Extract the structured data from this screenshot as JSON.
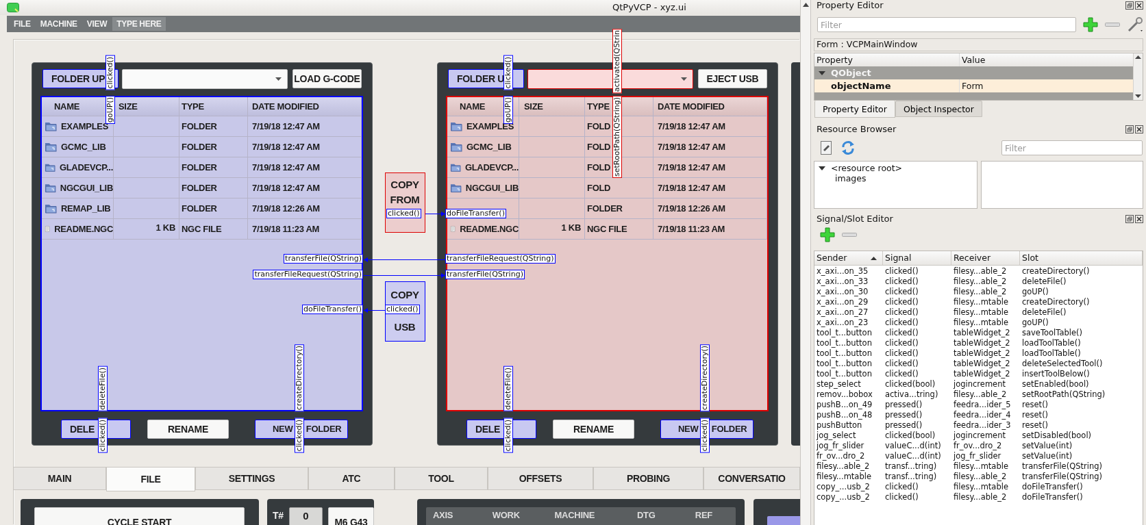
{
  "window": {
    "title": "QtPyVCP - xyz.ui"
  },
  "menu": [
    {
      "label": "FILE",
      "selected": false
    },
    {
      "label": "MACHINE",
      "selected": false
    },
    {
      "label": "VIEW",
      "selected": false
    },
    {
      "label": "TYPE HERE",
      "selected": true
    }
  ],
  "file_panels": [
    {
      "color": "#0000ff",
      "folder_up": {
        "label": "FOLDER UP",
        "highlighted": true
      },
      "combo": {
        "highlighted": false
      },
      "action": {
        "label": "LOAD G-CODE",
        "highlighted": false
      },
      "columns": [
        "NAME",
        "SIZE",
        "TYPE",
        "DATE MODIFIED"
      ],
      "rows": [
        {
          "kind": "folder",
          "name": "EXAMPLES",
          "type": "FOLDER",
          "date": "7/19/18 12:47 AM"
        },
        {
          "kind": "folder",
          "name": "GCMC_LIB",
          "type": "FOLDER",
          "date": "7/19/18 12:47 AM"
        },
        {
          "kind": "folder",
          "name": "GLADEVCP...",
          "type": "FOLDER",
          "date": "7/19/18 12:47 AM"
        },
        {
          "kind": "folder",
          "name": "NGCGUI_LIB",
          "type": "FOLDER",
          "date": "7/19/18 12:47 AM"
        },
        {
          "kind": "folder",
          "name": "REMAP_LIB",
          "type": "FOLDER",
          "date": "7/19/18 12:26 AM"
        },
        {
          "kind": "file",
          "name": "README.NGC",
          "size": "1 KB",
          "type": "NGC FILE",
          "date": "7/19/18 11:23 AM"
        }
      ],
      "buttons": [
        {
          "label": "DELE",
          "highlighted": true
        },
        {
          "label": "RENAME",
          "highlighted": false
        },
        {
          "label": "NEW FOLDER",
          "highlighted": true
        }
      ]
    },
    {
      "color": "#dd0000",
      "folder_up": {
        "label": "FOLDER U",
        "highlighted": true
      },
      "combo": {
        "highlighted": true
      },
      "action": {
        "label": "EJECT USB",
        "highlighted": false
      },
      "columns": [
        "NAME",
        "SIZE",
        "TYPE",
        "DATE MODIFIED"
      ],
      "rows": [
        {
          "kind": "folder",
          "name": "EXAMPLES",
          "type": "FOLD",
          "date": "7/19/18 12:47 AM"
        },
        {
          "kind": "folder",
          "name": "GCMC_LIB",
          "type": "FOLD",
          "date": "7/19/18 12:47 AM"
        },
        {
          "kind": "folder",
          "name": "GLADEVCP...",
          "type": "FOLD",
          "date": "7/19/18 12:47 AM"
        },
        {
          "kind": "folder",
          "name": "NGCGUI_LIB",
          "type": "FOLD",
          "date": "7/19/18 12:47 AM"
        },
        {
          "type": "FOLDER",
          "date": "7/19/18 12:26 AM"
        },
        {
          "kind": "file",
          "name": "README.NGC",
          "size": "1 KB",
          "type": "NGC FILE",
          "date": "7/19/18 11:23 AM"
        }
      ],
      "buttons": [
        {
          "label": "DELE",
          "highlighted": true
        },
        {
          "label": "RENAME",
          "highlighted": false
        },
        {
          "label": "NEW FOLDER",
          "highlighted": true
        }
      ]
    }
  ],
  "copy_buttons": [
    {
      "lines": [
        "COPY",
        "FROM"
      ],
      "color": "#dd0000"
    },
    {
      "lines": [
        "COPY",
        "USB"
      ],
      "color": "#0000ff"
    }
  ],
  "connections": [
    {
      "label": "clicked()",
      "color": "#0000ff"
    },
    {
      "label": "goUP()",
      "color": "#0000ff"
    },
    {
      "label": "transferFile(QString)",
      "color": "#0000ff"
    },
    {
      "label": "transferFileRequest(QString)",
      "color": "#0000ff"
    },
    {
      "label": "doFileTransfer()",
      "color": "#0000ff"
    },
    {
      "label": "clicked()",
      "color": "#0000ff"
    },
    {
      "label": "deleteFile()",
      "color": "#0000ff"
    },
    {
      "label": "clicked()",
      "color": "#0000ff"
    },
    {
      "label": "createDirectory()",
      "color": "#0000ff"
    },
    {
      "label": "clicked()",
      "color": "#0000ff"
    },
    {
      "label": "clicked()",
      "color": "#0000ff"
    },
    {
      "label": "goUP()",
      "color": "#0000ff"
    },
    {
      "label": "activated(QStrin",
      "color": "#dd0000"
    },
    {
      "label": "setRootPath(QString)",
      "color": "#dd0000"
    },
    {
      "label": "clicked()",
      "color": "#0000ff"
    },
    {
      "label": "doFileTransfer()",
      "color": "#0000ff"
    },
    {
      "label": "transferFileRequest(QString)",
      "color": "#0000ff"
    },
    {
      "label": "transferFile(QString)",
      "color": "#0000ff"
    },
    {
      "label": "deleteFile()",
      "color": "#0000ff"
    },
    {
      "label": "clicked()",
      "color": "#0000ff"
    },
    {
      "label": "createDirectory()",
      "color": "#0000ff"
    },
    {
      "label": "clicked()",
      "color": "#0000ff"
    }
  ],
  "tabs": [
    {
      "label": "MAIN",
      "selected": false
    },
    {
      "label": "FILE",
      "selected": true
    },
    {
      "label": "SETTINGS",
      "selected": false
    },
    {
      "label": "ATC",
      "selected": false
    },
    {
      "label": "TOOL",
      "selected": false
    },
    {
      "label": "OFFSETS",
      "selected": false
    },
    {
      "label": "PROBING",
      "selected": false
    },
    {
      "label": "CONVERSATIO",
      "selected": false
    }
  ],
  "bottom": {
    "cycle_start": "CYCLE START",
    "tool_label": "T#",
    "tool_number": "0",
    "tool_change": "M6 G43",
    "dro_columns": [
      "AXIS",
      "WORK",
      "MACHINE",
      "DTG",
      "REF"
    ]
  },
  "property_editor": {
    "title": "Property Editor",
    "filter_placeholder": "Filter",
    "form": "Form : VCPMainWindow",
    "columns": [
      "Property",
      "Value"
    ],
    "groups": [
      {
        "name": "QObject",
        "expanded": true,
        "properties": [
          {
            "name": "objectName",
            "value": "Form"
          }
        ]
      }
    ],
    "tabs": [
      {
        "label": "Property Editor",
        "selected": true
      },
      {
        "label": "Object Inspector",
        "selected": false
      }
    ]
  },
  "resource_browser": {
    "title": "Resource Browser",
    "filter_placeholder": "Filter",
    "tree": [
      {
        "label": "<resource root>",
        "expanded": true,
        "children": [
          {
            "label": "images"
          }
        ]
      }
    ]
  },
  "signal_slot_editor": {
    "title": "Signal/Slot Editor",
    "columns": [
      {
        "label": "Sender",
        "sorted": true
      },
      {
        "label": "Signal",
        "sorted": false
      },
      {
        "label": "Receiver",
        "sorted": false
      },
      {
        "label": "Slot",
        "sorted": false
      }
    ],
    "rows": [
      {
        "sender": "x_axi...on_35",
        "signal": "clicked()",
        "receiver": "filesy...able_2",
        "slot": "createDirectory()"
      },
      {
        "sender": "x_axi...on_33",
        "signal": "clicked()",
        "receiver": "filesy...able_2",
        "slot": "deleteFile()"
      },
      {
        "sender": "x_axi...on_30",
        "signal": "clicked()",
        "receiver": "filesy...able_2",
        "slot": "goUP()"
      },
      {
        "sender": "x_axi...on_29",
        "signal": "clicked()",
        "receiver": "filesy...mtable",
        "slot": "createDirectory()"
      },
      {
        "sender": "x_axi...on_27",
        "signal": "clicked()",
        "receiver": "filesy...mtable",
        "slot": "deleteFile()"
      },
      {
        "sender": "x_axi...on_23",
        "signal": "clicked()",
        "receiver": "filesy...mtable",
        "slot": "goUP()"
      },
      {
        "sender": "tool_t...button",
        "signal": "clicked()",
        "receiver": "tableWidget_2",
        "slot": "saveToolTable()"
      },
      {
        "sender": "tool_t...button",
        "signal": "clicked()",
        "receiver": "tableWidget_2",
        "slot": "loadToolTable()"
      },
      {
        "sender": "tool_t...button",
        "signal": "clicked()",
        "receiver": "tableWidget_2",
        "slot": "loadToolTable()"
      },
      {
        "sender": "tool_t...button",
        "signal": "clicked()",
        "receiver": "tableWidget_2",
        "slot": "deleteSelectedTool()"
      },
      {
        "sender": "tool_t...button",
        "signal": "clicked()",
        "receiver": "tableWidget_2",
        "slot": "insertToolBelow()"
      },
      {
        "sender": "step_select",
        "signal": "clicked(bool)",
        "receiver": "jogincrement",
        "slot": "setEnabled(bool)"
      },
      {
        "sender": "remov...bobox",
        "signal": "activa...tring)",
        "receiver": "filesy...able_2",
        "slot": "setRootPath(QString)"
      },
      {
        "sender": "pushB...on_49",
        "signal": "pressed()",
        "receiver": "feedra...ider_5",
        "slot": "reset()"
      },
      {
        "sender": "pushB...on_48",
        "signal": "pressed()",
        "receiver": "feedra...ider_4",
        "slot": "reset()"
      },
      {
        "sender": "pushButton",
        "signal": "pressed()",
        "receiver": "feedra...ider_3",
        "slot": "reset()"
      },
      {
        "sender": "jog_select",
        "signal": "clicked(bool)",
        "receiver": "jogincrement",
        "slot": "setDisabled(bool)"
      },
      {
        "sender": "jog_fr_slider",
        "signal": "valueC...d(int)",
        "receiver": "fr_ov...dro_2",
        "slot": "setValue(int)"
      },
      {
        "sender": "fr_ov...dro_2",
        "signal": "valueC...d(int)",
        "receiver": "jog_fr_slider",
        "slot": "setValue(int)"
      },
      {
        "sender": "filesy...able_2",
        "signal": "transf...tring)",
        "receiver": "filesy...mtable",
        "slot": "transferFile(QString)"
      },
      {
        "sender": "filesy...mtable",
        "signal": "transf...tring)",
        "receiver": "filesy...able_2",
        "slot": "transferFile(QString)"
      },
      {
        "sender": "copy_...usb_2",
        "signal": "clicked()",
        "receiver": "filesy...mtable",
        "slot": "doFileTransfer()"
      },
      {
        "sender": "copy_...usb_2",
        "signal": "clicked()",
        "receiver": "filesy...able_2",
        "slot": "doFileTransfer()"
      }
    ]
  }
}
